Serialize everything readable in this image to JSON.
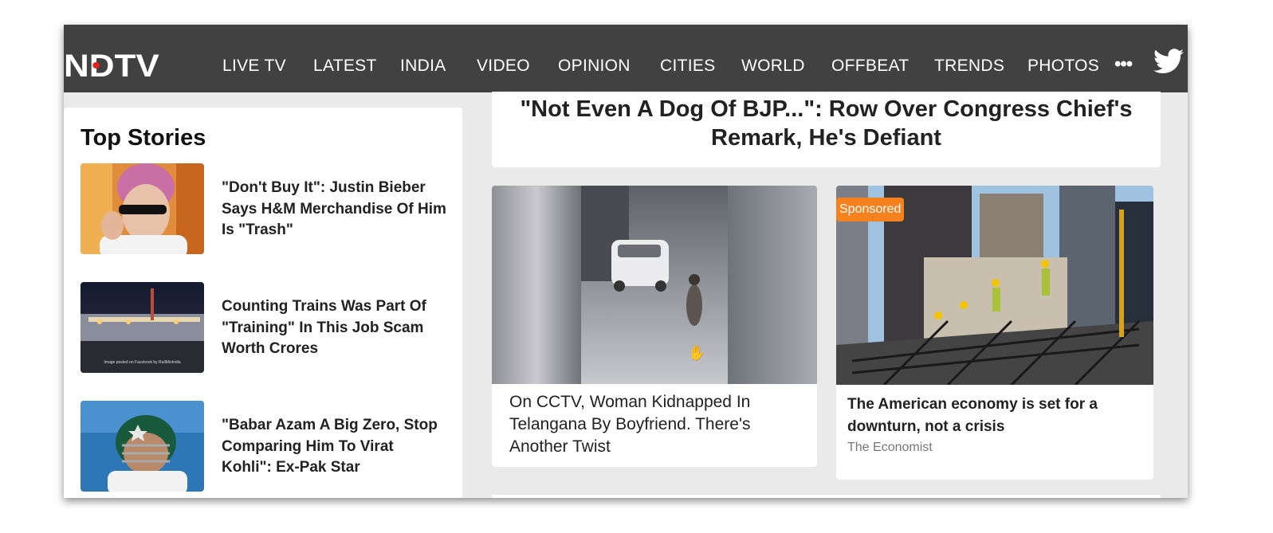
{
  "brand": {
    "logo_text": "NDTV",
    "accent": "#e2231a",
    "nav_bg": "#414141"
  },
  "nav": {
    "items": [
      "LIVE TV",
      "LATEST",
      "INDIA",
      "VIDEO",
      "OPINION",
      "CITIES",
      "WORLD",
      "OFFBEAT",
      "TRENDS",
      "PHOTOS"
    ],
    "more_icon": "more-dots-icon",
    "twitter_icon": "twitter-bird-icon"
  },
  "headline": "\"Not Even A Dog Of BJP...\": Row Over Congress Chief's Remark, He's Defiant",
  "top_stories": {
    "heading": "Top Stories",
    "items": [
      {
        "title": "\"Don't Buy It\": Justin Bieber Says H&M Merchandise Of Him Is \"Trash\""
      },
      {
        "title": "Counting Trains Was Part Of \"Training\" In This Job Scam Worth Crores",
        "image_caption": "Image posted on Facebook by RailMinIndia"
      },
      {
        "title": "\"Babar Azam A Big Zero, Stop Comparing Him To Virat Kohli\": Ex-Pak Star"
      }
    ]
  },
  "video_story": {
    "title": "On CCTV, Woman Kidnapped In Telangana By Boyfriend. There's Another Twist"
  },
  "sponsored": {
    "badge": "Sponsored",
    "badge_color": "#f5821f",
    "title": "The American economy is set for a downturn, not a crisis",
    "source": "The Economist"
  }
}
